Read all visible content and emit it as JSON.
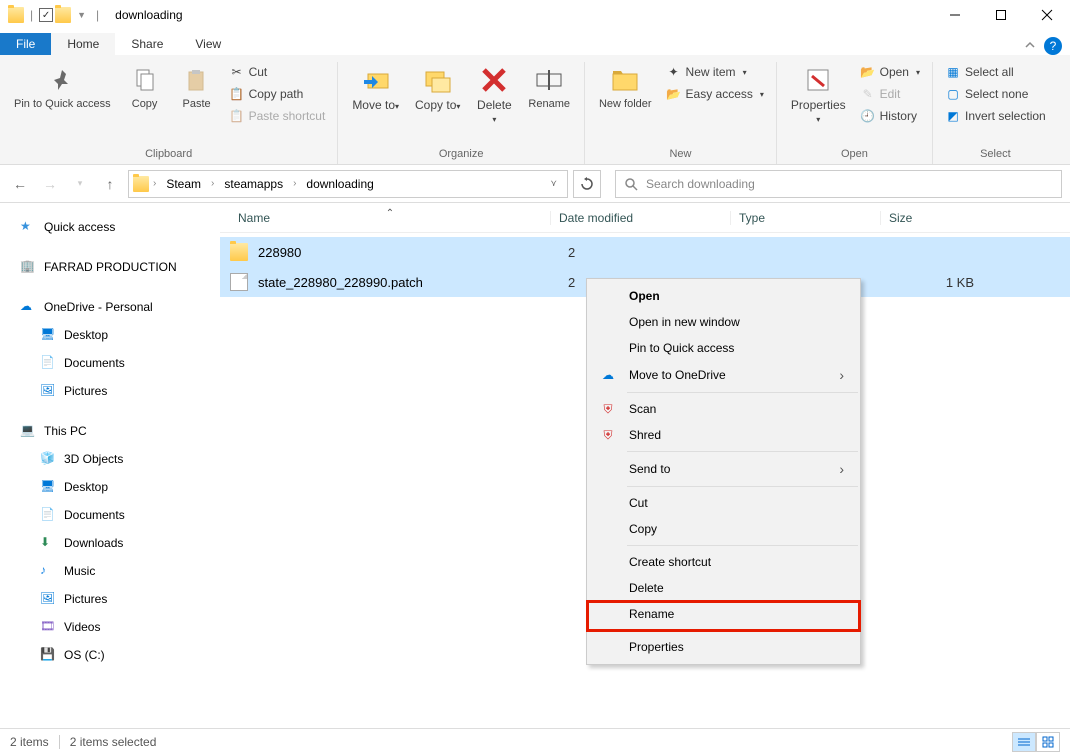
{
  "window": {
    "title": "downloading"
  },
  "tabs": {
    "file": "File",
    "home": "Home",
    "share": "Share",
    "view": "View"
  },
  "ribbon": {
    "clipboard": {
      "label": "Clipboard",
      "pin": "Pin to Quick access",
      "copy": "Copy",
      "paste": "Paste",
      "cut": "Cut",
      "copy_path": "Copy path",
      "paste_shortcut": "Paste shortcut"
    },
    "organize": {
      "label": "Organize",
      "move": "Move to",
      "copy": "Copy to",
      "delete": "Delete",
      "rename": "Rename"
    },
    "new": {
      "label": "New",
      "new_folder": "New folder",
      "new_item": "New item",
      "easy_access": "Easy access"
    },
    "open": {
      "label": "Open",
      "properties": "Properties",
      "open": "Open",
      "edit": "Edit",
      "history": "History"
    },
    "select": {
      "label": "Select",
      "all": "Select all",
      "none": "Select none",
      "invert": "Invert selection"
    }
  },
  "breadcrumb": [
    "Steam",
    "steamapps",
    "downloading"
  ],
  "search": {
    "placeholder": "Search downloading"
  },
  "columns": {
    "name": "Name",
    "date": "Date modified",
    "type": "Type",
    "size": "Size"
  },
  "sidebar": {
    "quick": "Quick access",
    "farrad": "FARRAD PRODUCTION",
    "onedrive": "OneDrive - Personal",
    "od_desktop": "Desktop",
    "od_documents": "Documents",
    "od_pictures": "Pictures",
    "thispc": "This PC",
    "pc_3d": "3D Objects",
    "pc_desktop": "Desktop",
    "pc_documents": "Documents",
    "pc_downloads": "Downloads",
    "pc_music": "Music",
    "pc_pictures": "Pictures",
    "pc_videos": "Videos",
    "pc_os": "OS (C:)"
  },
  "rows": [
    {
      "name": "228980",
      "date": "2",
      "size": "",
      "type": "folder"
    },
    {
      "name": "state_228980_228990.patch",
      "date": "2",
      "size": "1 KB",
      "type": "file"
    }
  ],
  "context_menu": {
    "open": "Open",
    "open_new": "Open in new window",
    "pin": "Pin to Quick access",
    "onedrive": "Move to OneDrive",
    "scan": "Scan",
    "shred": "Shred",
    "sendto": "Send to",
    "cut": "Cut",
    "copy": "Copy",
    "create_shortcut": "Create shortcut",
    "delete": "Delete",
    "rename": "Rename",
    "properties": "Properties"
  },
  "status": {
    "items": "2 items",
    "selected": "2 items selected"
  }
}
